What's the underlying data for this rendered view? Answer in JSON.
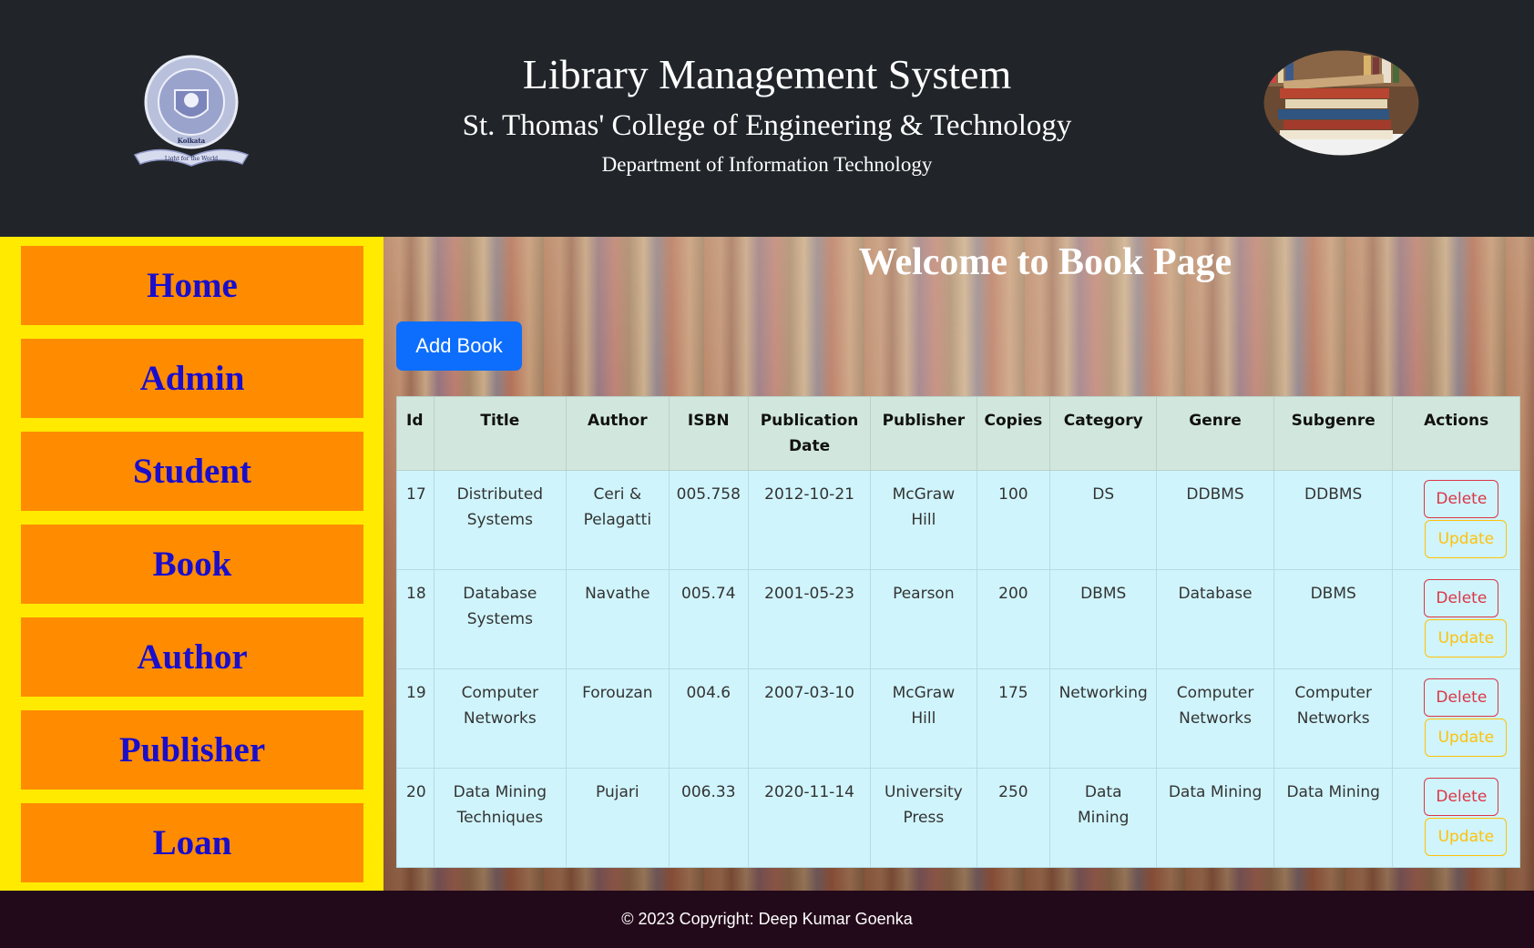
{
  "header": {
    "title": "Library Management System",
    "college": "St. Thomas' College of Engineering & Technology",
    "department": "Department of Information Technology",
    "logo_texts": [
      "St. Thomas' College of Engineering & Technology",
      "Kolkata",
      "Light for the World"
    ]
  },
  "sidebar": {
    "items": [
      {
        "label": "Home"
      },
      {
        "label": "Admin"
      },
      {
        "label": "Student"
      },
      {
        "label": "Book"
      },
      {
        "label": "Author"
      },
      {
        "label": "Publisher"
      },
      {
        "label": "Loan"
      }
    ]
  },
  "main": {
    "heading": "Welcome to Book Page",
    "add_button": "Add Book",
    "table": {
      "columns": [
        "Id",
        "Title",
        "Author",
        "ISBN",
        "Publication Date",
        "Publisher",
        "Copies",
        "Category",
        "Genre",
        "Subgenre",
        "Actions"
      ],
      "rows": [
        {
          "id": "17",
          "title": "Distributed Systems",
          "author": "Ceri & Pelagatti",
          "isbn": "005.758",
          "date": "2012-10-21",
          "publisher": "McGraw Hill",
          "copies": "100",
          "category": "DS",
          "genre": "DDBMS",
          "subgenre": "DDBMS"
        },
        {
          "id": "18",
          "title": "Database Systems",
          "author": "Navathe",
          "isbn": "005.74",
          "date": "2001-05-23",
          "publisher": "Pearson",
          "copies": "200",
          "category": "DBMS",
          "genre": "Database",
          "subgenre": "DBMS"
        },
        {
          "id": "19",
          "title": "Computer Networks",
          "author": "Forouzan",
          "isbn": "004.6",
          "date": "2007-03-10",
          "publisher": "McGraw Hill",
          "copies": "175",
          "category": "Networking",
          "genre": "Computer Networks",
          "subgenre": "Computer Networks"
        },
        {
          "id": "20",
          "title": "Data Mining Techniques",
          "author": "Pujari",
          "isbn": "006.33",
          "date": "2020-11-14",
          "publisher": "University Press",
          "copies": "250",
          "category": "Data Mining",
          "genre": "Data Mining",
          "subgenre": "Data Mining"
        }
      ],
      "delete_label": "Delete",
      "update_label": "Update"
    }
  },
  "footer": {
    "text": "© 2023 Copyright: Deep Kumar Goenka"
  },
  "colors": {
    "header_bg": "#212529",
    "sidebar_bg": "#ffea00",
    "nav_item_bg": "#ff8c00",
    "nav_text": "#1a0dcc",
    "primary": "#0d6efd",
    "danger": "#dc3545",
    "warning": "#ffc107",
    "table_head": "#d1e7dd",
    "table_body": "#cff4fc",
    "footer_bg": "#230a1a"
  }
}
